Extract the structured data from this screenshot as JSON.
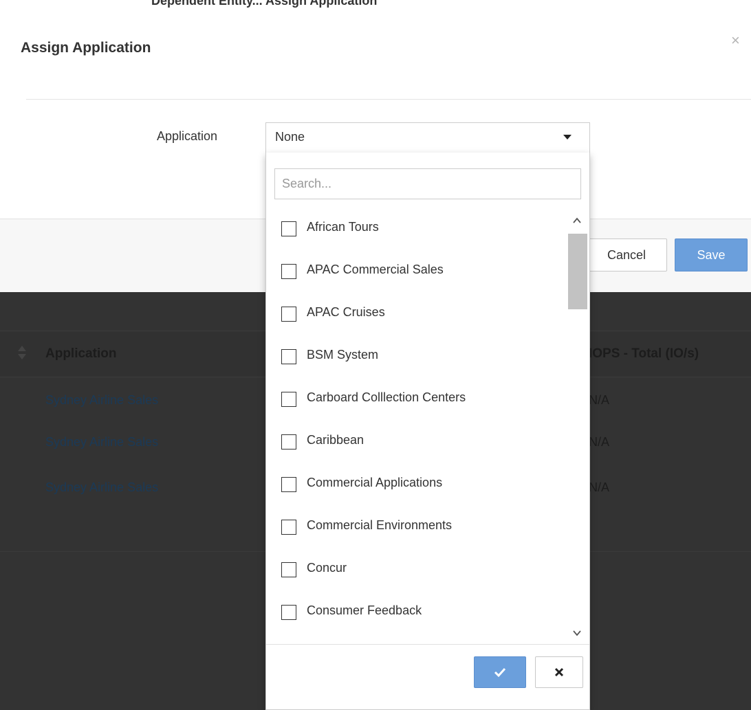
{
  "top_strip": {
    "text": "Dependent Entity... Assign Application"
  },
  "modal": {
    "title": "Assign Application",
    "close_glyph": "×",
    "field_label": "Application",
    "selected_value": "None",
    "cancel_label": "Cancel",
    "save_label": "Save"
  },
  "dropdown": {
    "search_placeholder": "Search...",
    "options": [
      {
        "label": "African Tours",
        "checked": false
      },
      {
        "label": "APAC Commercial Sales",
        "checked": false
      },
      {
        "label": "APAC Cruises",
        "checked": false
      },
      {
        "label": "BSM System",
        "checked": false
      },
      {
        "label": "Carboard Colllection Centers",
        "checked": false
      },
      {
        "label": "Caribbean",
        "checked": false
      },
      {
        "label": "Commercial Applications",
        "checked": false
      },
      {
        "label": "Commercial Environments",
        "checked": false
      },
      {
        "label": "Concur",
        "checked": false
      },
      {
        "label": "Consumer Feedback",
        "checked": false
      }
    ],
    "confirm_icon": "check-icon",
    "clear_icon": "close-icon"
  },
  "background_table": {
    "headers": {
      "application": "Application",
      "iops": "IOPS - Total (IO/s)"
    },
    "rows": [
      {
        "application": "Sydney Airline Sales",
        "iops": "N/A"
      },
      {
        "application": "Sydney Airline Sales",
        "iops": "N/A"
      },
      {
        "application": "Sydney Airline Sales",
        "iops": "N/A"
      }
    ]
  },
  "colors": {
    "primary_button": "#6b9fdc",
    "overlay": "#333333",
    "link": "#1b3a57"
  }
}
